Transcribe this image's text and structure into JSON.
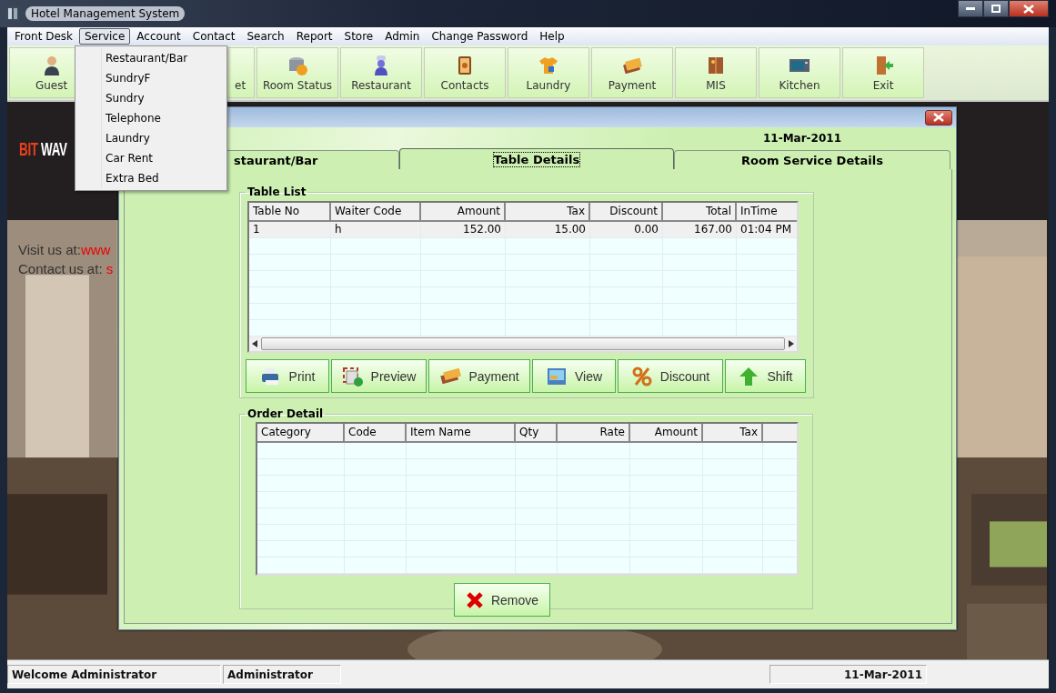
{
  "window": {
    "title": "Hotel Management System"
  },
  "menu": [
    {
      "label": "Front  Desk",
      "selected": false
    },
    {
      "label": "Service",
      "selected": true
    },
    {
      "label": "Account",
      "selected": false
    },
    {
      "label": "Contact",
      "selected": false
    },
    {
      "label": "Search",
      "selected": false
    },
    {
      "label": "Report",
      "selected": false
    },
    {
      "label": "Store",
      "selected": false
    },
    {
      "label": "Admin",
      "selected": false
    },
    {
      "label": "Change Password",
      "selected": false
    },
    {
      "label": "Help",
      "selected": false
    }
  ],
  "service_menu": [
    "Restaurant/Bar",
    "SundryF",
    "Sundry",
    "Telephone",
    "Laundry",
    "Car Rent",
    "Extra Bed"
  ],
  "toolbar": [
    {
      "label": "Guest",
      "kind": "guest"
    },
    {
      "label": "et",
      "kind": "covered"
    },
    {
      "label": "Room Status",
      "kind": "status"
    },
    {
      "label": "Restaurant",
      "kind": "chef"
    },
    {
      "label": "Contacts",
      "kind": "contacts"
    },
    {
      "label": "Laundry",
      "kind": "laundry"
    },
    {
      "label": "Payment",
      "kind": "payment"
    },
    {
      "label": "MIS",
      "kind": "mis"
    },
    {
      "label": "Kitchen",
      "kind": "kitchen"
    },
    {
      "label": "Exit",
      "kind": "exit"
    }
  ],
  "background": {
    "logo_first": "BIT",
    "logo_second": "WAV",
    "lines": [
      {
        "label": "Visit us at:",
        "link": "www"
      },
      {
        "label": "Contact us at: ",
        "link": "s"
      }
    ]
  },
  "dialog": {
    "date": "11-Mar-2011",
    "tabs": [
      {
        "label": "staurant/Bar",
        "selected": false
      },
      {
        "label": "Table Details",
        "selected": true
      },
      {
        "label": "Room Service Details",
        "selected": false
      }
    ],
    "table_list": {
      "title": "Table List",
      "columns": [
        "Table No",
        "Waiter Code",
        "Amount",
        "Tax",
        "Discount",
        "Total",
        "InTime"
      ],
      "rows": [
        {
          "cells": [
            "1",
            "h",
            "152.00",
            "15.00",
            "0.00",
            "167.00",
            "01:04 PM"
          ],
          "selected": true
        }
      ]
    },
    "buttons": [
      {
        "label": "Print",
        "kind": "print"
      },
      {
        "label": "Preview",
        "kind": "preview"
      },
      {
        "label": "Payment",
        "kind": "payment"
      },
      {
        "label": "View",
        "kind": "view"
      },
      {
        "label": "Discount",
        "kind": "discount"
      },
      {
        "label": "Shift",
        "kind": "shift"
      }
    ],
    "order_detail": {
      "title": "Order Detail",
      "columns": [
        "Category",
        "Code",
        "Item Name",
        "Qty",
        "Rate",
        "Amount",
        "Tax"
      ]
    },
    "remove_button": "Remove"
  },
  "status_bar": [
    "Welcome Administrator",
    "Administrator",
    "11-Mar-2011"
  ]
}
